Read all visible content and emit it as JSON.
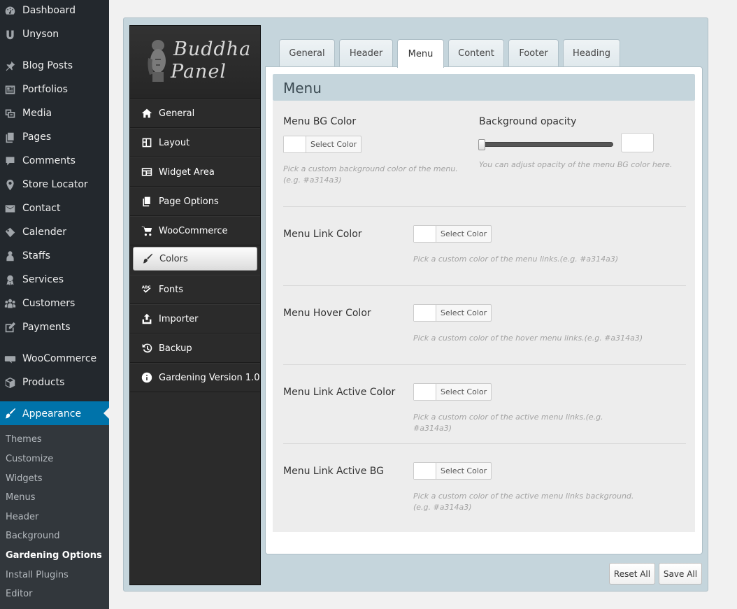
{
  "wp_sidebar": {
    "items": [
      {
        "label": "Dashboard",
        "icon": "dashboard-icon"
      },
      {
        "label": "Unyson",
        "icon": "unyson-icon"
      },
      {
        "label": "Blog Posts",
        "icon": "pin-icon"
      },
      {
        "label": "Portfolios",
        "icon": "portfolio-icon"
      },
      {
        "label": "Media",
        "icon": "media-icon"
      },
      {
        "label": "Pages",
        "icon": "pages-icon"
      },
      {
        "label": "Comments",
        "icon": "comment-icon"
      },
      {
        "label": "Store Locator",
        "icon": "location-pin-icon"
      },
      {
        "label": "Contact",
        "icon": "envelope-icon"
      },
      {
        "label": "Calender",
        "icon": "tag-icon"
      },
      {
        "label": "Staffs",
        "icon": "users-icon"
      },
      {
        "label": "Services",
        "icon": "award-icon"
      },
      {
        "label": "Customers",
        "icon": "groups-icon"
      },
      {
        "label": "Payments",
        "icon": "edit-icon"
      },
      {
        "label": "WooCommerce",
        "icon": "woocommerce-icon"
      },
      {
        "label": "Products",
        "icon": "box-icon"
      },
      {
        "label": "Appearance",
        "icon": "paintbrush-icon"
      }
    ],
    "submenu": [
      "Themes",
      "Customize",
      "Widgets",
      "Menus",
      "Header",
      "Background",
      "Gardening Options",
      "Install Plugins",
      "Editor"
    ]
  },
  "panel": {
    "logo_line1": "Buddha",
    "logo_line2": "Panel",
    "nav": [
      {
        "label": "General",
        "icon": "home-icon"
      },
      {
        "label": "Layout",
        "icon": "layout-icon"
      },
      {
        "label": "Widget Area",
        "icon": "widget-grid-icon"
      },
      {
        "label": "Page Options",
        "icon": "pages-icon"
      },
      {
        "label": "WooCommerce",
        "icon": "cart-icon"
      },
      {
        "label": "Colors",
        "icon": "paintbrush-icon"
      },
      {
        "label": "Fonts",
        "icon": "spellcheck-icon"
      },
      {
        "label": "Importer",
        "icon": "upload-icon"
      },
      {
        "label": "Backup",
        "icon": "history-icon"
      },
      {
        "label": "Gardening Version 1.0",
        "icon": "info-icon"
      }
    ],
    "tabs": [
      "General",
      "Header",
      "Menu",
      "Content",
      "Footer",
      "Heading"
    ],
    "active_tab": "Menu",
    "section_title": "Menu",
    "select_color_label": "Select Color",
    "options": {
      "bg_color": {
        "label": "Menu BG Color",
        "desc": "Pick a custom background color of the menu.(e.g. #a314a3)"
      },
      "opacity": {
        "label": "Background opacity",
        "desc": "You can adjust opacity of the menu BG color here.",
        "value": 0
      },
      "link_color": {
        "label": "Menu Link Color",
        "desc": "Pick a custom color of the menu links.(e.g. #a314a3)"
      },
      "hover_color": {
        "label": "Menu Hover Color",
        "desc": "Pick a custom color of the hover menu links.(e.g. #a314a3)"
      },
      "active_color": {
        "label": "Menu Link Active Color",
        "desc": "Pick a custom color of the active menu links.(e.g. #a314a3)"
      },
      "active_bg": {
        "label": "Menu Link Active BG",
        "desc": "Pick a custom color of the active menu links background.(e.g. #a314a3)"
      }
    },
    "reset_label": "Reset All",
    "save_label": "Save All"
  },
  "colors": {
    "wp_sidebar": "#23282d",
    "wp_active": "#0073aa",
    "panel_bg": "#c5d5dc"
  }
}
